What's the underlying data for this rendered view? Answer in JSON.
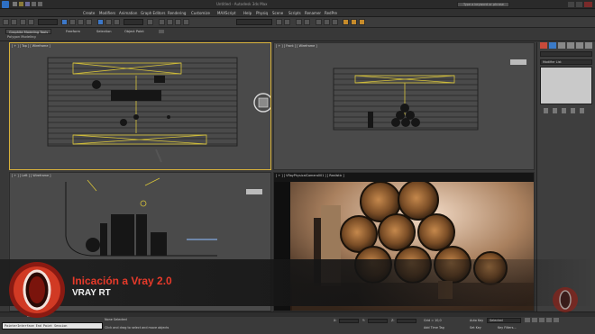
{
  "window": {
    "title": "Untitled - Autodesk 3ds Max",
    "search_placeholder": "Type a keyword or phrase"
  },
  "menu": {
    "items": [
      "Create",
      "Modifiers",
      "Animation",
      "Graph Editors",
      "Rendering",
      "Customize",
      "MAXScript",
      "Help",
      "Physiq",
      "Scene",
      "Scripts",
      "Renamer",
      "RedPre"
    ]
  },
  "ribbon": {
    "tabs": [
      "Graphite Modeling Tools",
      "Freeform",
      "Selection",
      "Object Paint"
    ],
    "active_tab": "Graphite Modeling Tools",
    "subtitle": "Polygon Modeling"
  },
  "viewports": {
    "top": "[ + ] [ Top ] [ Wireframe ]",
    "front": "[ + ] [ Front ] [ Wireframe ]",
    "left": "[ + ] [ Left ] [ Wireframe ]",
    "render": "[ + ] [ VRayPhysicalCamera001 ] [ Realistic ]"
  },
  "command_panel": {
    "modifier_list": "Modifier List"
  },
  "status": {
    "maxscript": "PainterInterface End Paint Session",
    "selection": "None Selected",
    "prompt": "Click and drag to select and move objects",
    "x_label": "X:",
    "y_label": "Y:",
    "z_label": "Z:",
    "grid": "Grid = 10,0",
    "add_time_tag": "Add Time Tag",
    "auto_key": "Auto Key",
    "selected_option": "Selected",
    "set_key": "Set Key",
    "key_filters": "Key Filters..."
  },
  "overlay": {
    "title": "Inicación a Vray 2.0",
    "subtitle": "VRAY RT"
  },
  "colors": {
    "accent_red": "#e83a2a",
    "active_viewport_border": "#d9b23a",
    "wire_yellow": "#d6c23a"
  }
}
